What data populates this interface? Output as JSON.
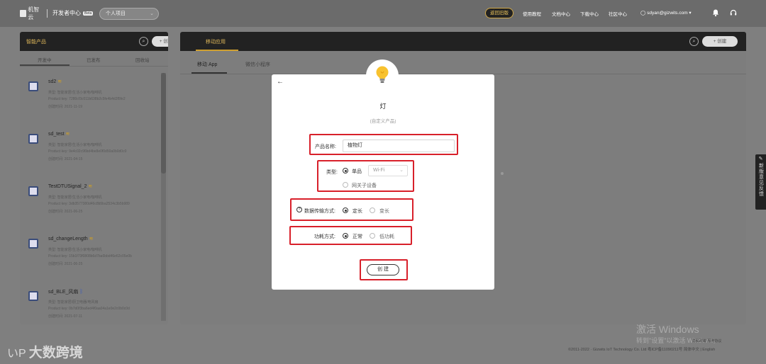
{
  "header": {
    "logo_text": "机智云",
    "dev_center": "开发者中心",
    "beta_badge": "Beta",
    "project_select": "个人项目",
    "back_old": "返回旧版",
    "nav": [
      "使用教程",
      "文档中心",
      "下载中心",
      "社区中心"
    ],
    "user": "sdyan@gizwits.com ▾"
  },
  "left_panel": {
    "title": "智能产品",
    "create_label": "创建",
    "tabs": [
      "开发中",
      "已发布",
      "回收站"
    ],
    "products": [
      {
        "name": "sd2",
        "conn": "wifi",
        "line1": "类型: 智能家居/生活小家电/咖啡机",
        "line2": "Product key: 7280cf3c011b638b2c5fe4b4d2f5fe2",
        "line3": "创建时间: 2021-11-19"
      },
      {
        "name": "sd_test",
        "conn": "wifi",
        "line1": "类型: 智能家居/生活小家电/咖啡机",
        "line2": "Product key: 9e4c02c96bd4be8e0f0d50a0b0d0c0",
        "line3": "创建时间: 2021-04-15"
      },
      {
        "name": "TestDTUSignal_2",
        "conn": "wifi",
        "line1": "类型: 智能家居/生活小家电/咖啡机",
        "line2": "Product key: 3db3577380d46c8b5ba2534c3b5b989",
        "line3": "创建时间: 2021-06-25"
      },
      {
        "name": "sd_changeLength",
        "conn": "wifi",
        "line1": "类型: 智能家居/生活小家电/咖啡机",
        "line2": "Product key: 15b1f73f0808b6d7ba6bbd46e62c05e0b",
        "line3": "创建时间: 2021-06-25"
      },
      {
        "name": "sd_BLE_风扇",
        "conn": "bluetooth",
        "line1": "类型: 智能家居/厨卫电器/电风扇",
        "line2": "Product key: 0b7d0f3ba6ed4f0aa04a1e0e2c0b0c0d",
        "line3": "创建时间: 2021-07-11"
      }
    ]
  },
  "right_panel": {
    "title": "移动应用",
    "create_label": "创建",
    "tabs": [
      "移动 App",
      "微信小程序"
    ]
  },
  "feedback": "新版意见反馈",
  "modal": {
    "title": "灯",
    "subtitle": "(自定义产品)",
    "name_label": "产品名称:",
    "name_value": "植物灯",
    "type_label": "类型:",
    "type_options": [
      "单品",
      "网关子设备"
    ],
    "type_select": "Wi-Fi",
    "transfer_label": "数据传输方式:",
    "transfer_options": [
      "定长",
      "变长"
    ],
    "power_label": "功耗方式:",
    "power_options": [
      "正常",
      "低功耗"
    ],
    "create_button": "创 建"
  },
  "footer": {
    "activate_title": "激活 Windows",
    "activate_sub": "转到\"设置\"以激活 Windows。",
    "links": "隐私政策 服务协议",
    "copyright": "©2011-2022 · Gizwits IoT Technology Co. Ltd 粤ICP备11090211号 简体中文 | English"
  },
  "watermark": {
    "logo": "いP",
    "text": "大数跨境"
  }
}
